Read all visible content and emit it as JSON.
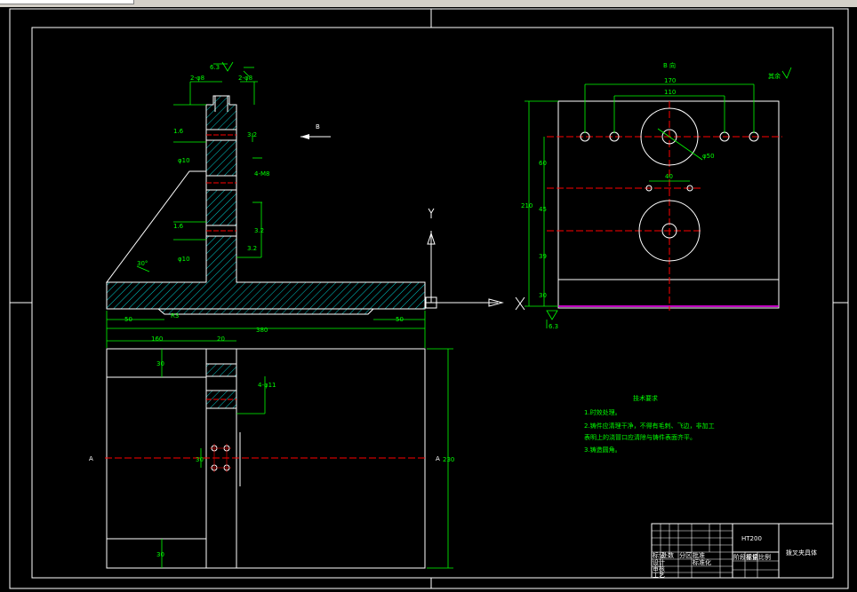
{
  "view_label": "B 向",
  "roughness_note": "其余",
  "tech_req": {
    "title": "技术要求",
    "lines": [
      "1.时效处理。",
      "2.铸件应清理干净，不得有毛刺、飞边，非加工",
      "表明上的浇冒口应清除与铸件表面齐平。",
      "3.铸造圆角。"
    ]
  },
  "title_block": {
    "material": "HT200",
    "drawing_name": "拨叉夹具体",
    "small_labels": [
      "标记",
      "处数",
      "设计",
      "审核",
      "工艺",
      "批准",
      "分区",
      "标准化",
      "阶段标记",
      "重量",
      "比例"
    ]
  },
  "section_labels": {
    "a_left": "A",
    "a_right": "A",
    "b_arrow": "B"
  },
  "axis": {
    "y": "Y",
    "x": "X"
  },
  "dims": {
    "d170": "170",
    "d110": "110",
    "d40": "40",
    "d210": "210",
    "d60": "60",
    "d45": "45",
    "d39": "39",
    "d30": "30",
    "phi50": "φ50",
    "d380": "380",
    "d160": "160",
    "d20": "20",
    "d50a": "50",
    "d50b": "50",
    "d230": "230",
    "d30b": "30",
    "d30c": "30",
    "d30d": "30",
    "angle": "30°",
    "hole_a": "2-φ8",
    "hole_b": "2-φ8",
    "hole_c": "4-φ11",
    "hole_d": "4-M8",
    "thread1": "φ10",
    "thread2": "φ10",
    "rough1": "3.2",
    "rough2": "3.2",
    "rough3": "1.6",
    "rough4": "1.6",
    "rough5": "3.2",
    "rough6": "6.3",
    "bottom_rough": "6.3",
    "r10": "R3"
  },
  "colors": {
    "line": "#ffffff",
    "dim": "#00ff00",
    "center": "#ff0000",
    "hatch": "#00c8c8",
    "magenta": "#ff00ff",
    "background": "#000000"
  }
}
